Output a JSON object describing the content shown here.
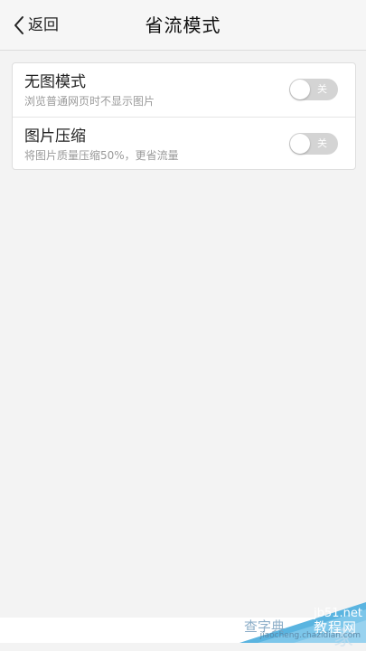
{
  "header": {
    "back_label": "返回",
    "title": "省流模式"
  },
  "settings": {
    "items": [
      {
        "title": "无图模式",
        "subtitle": "浏览普通网页时不显示图片",
        "toggle_label": "关",
        "enabled": false
      },
      {
        "title": "图片压缩",
        "subtitle": "将图片质量压缩50%，更省流量",
        "toggle_label": "关",
        "enabled": false
      }
    ]
  },
  "watermark": {
    "domain": "jb51.net",
    "brand": "教程网",
    "left_text": "查字典",
    "url": "jiaocheng.chazidian.com",
    "shadow_text": "家"
  },
  "colors": {
    "background": "#f3f3f3",
    "card": "#ffffff",
    "toggle_off": "#d4d4d4",
    "watermark_blue": "#5ab4e0"
  },
  "icons": {
    "back": "chevron-left-icon"
  }
}
